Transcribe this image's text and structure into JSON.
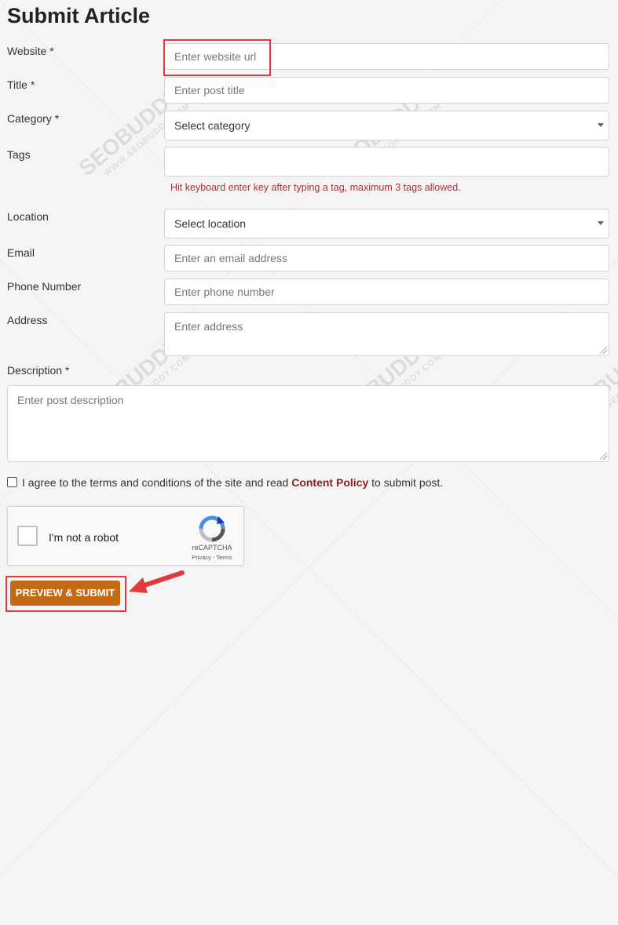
{
  "page": {
    "title": "Submit Article"
  },
  "fields": {
    "website": {
      "label": "Website *",
      "placeholder": "Enter website url"
    },
    "title": {
      "label": "Title *",
      "placeholder": "Enter post title"
    },
    "category": {
      "label": "Category *",
      "value": "Select category"
    },
    "tags": {
      "label": "Tags",
      "placeholder": "",
      "hint": "Hit keyboard enter key after typing a tag, maximum 3 tags allowed."
    },
    "location": {
      "label": "Location",
      "value": "Select location"
    },
    "email": {
      "label": "Email",
      "placeholder": "Enter an email address"
    },
    "phone": {
      "label": "Phone Number",
      "placeholder": "Enter phone number"
    },
    "address": {
      "label": "Address",
      "placeholder": "Enter address"
    },
    "description": {
      "label": "Description *",
      "placeholder": "Enter post description"
    }
  },
  "agree": {
    "text_before": "I agree to the terms and conditions of the site and read ",
    "link": "Content Policy",
    "text_after": " to submit post."
  },
  "captcha": {
    "label": "I'm not a robot",
    "brand": "reCAPTCHA",
    "links": "Privacy - Terms"
  },
  "submit": {
    "label": "PREVIEW & SUBMIT"
  },
  "watermark": {
    "brand": "SEOBUDDY",
    "domain": "WWW.SEOBUDDY.COM"
  },
  "colors": {
    "accent": "#c46a14",
    "highlight": "#e0393e",
    "hint": "#a33333",
    "link": "#8b2020"
  }
}
